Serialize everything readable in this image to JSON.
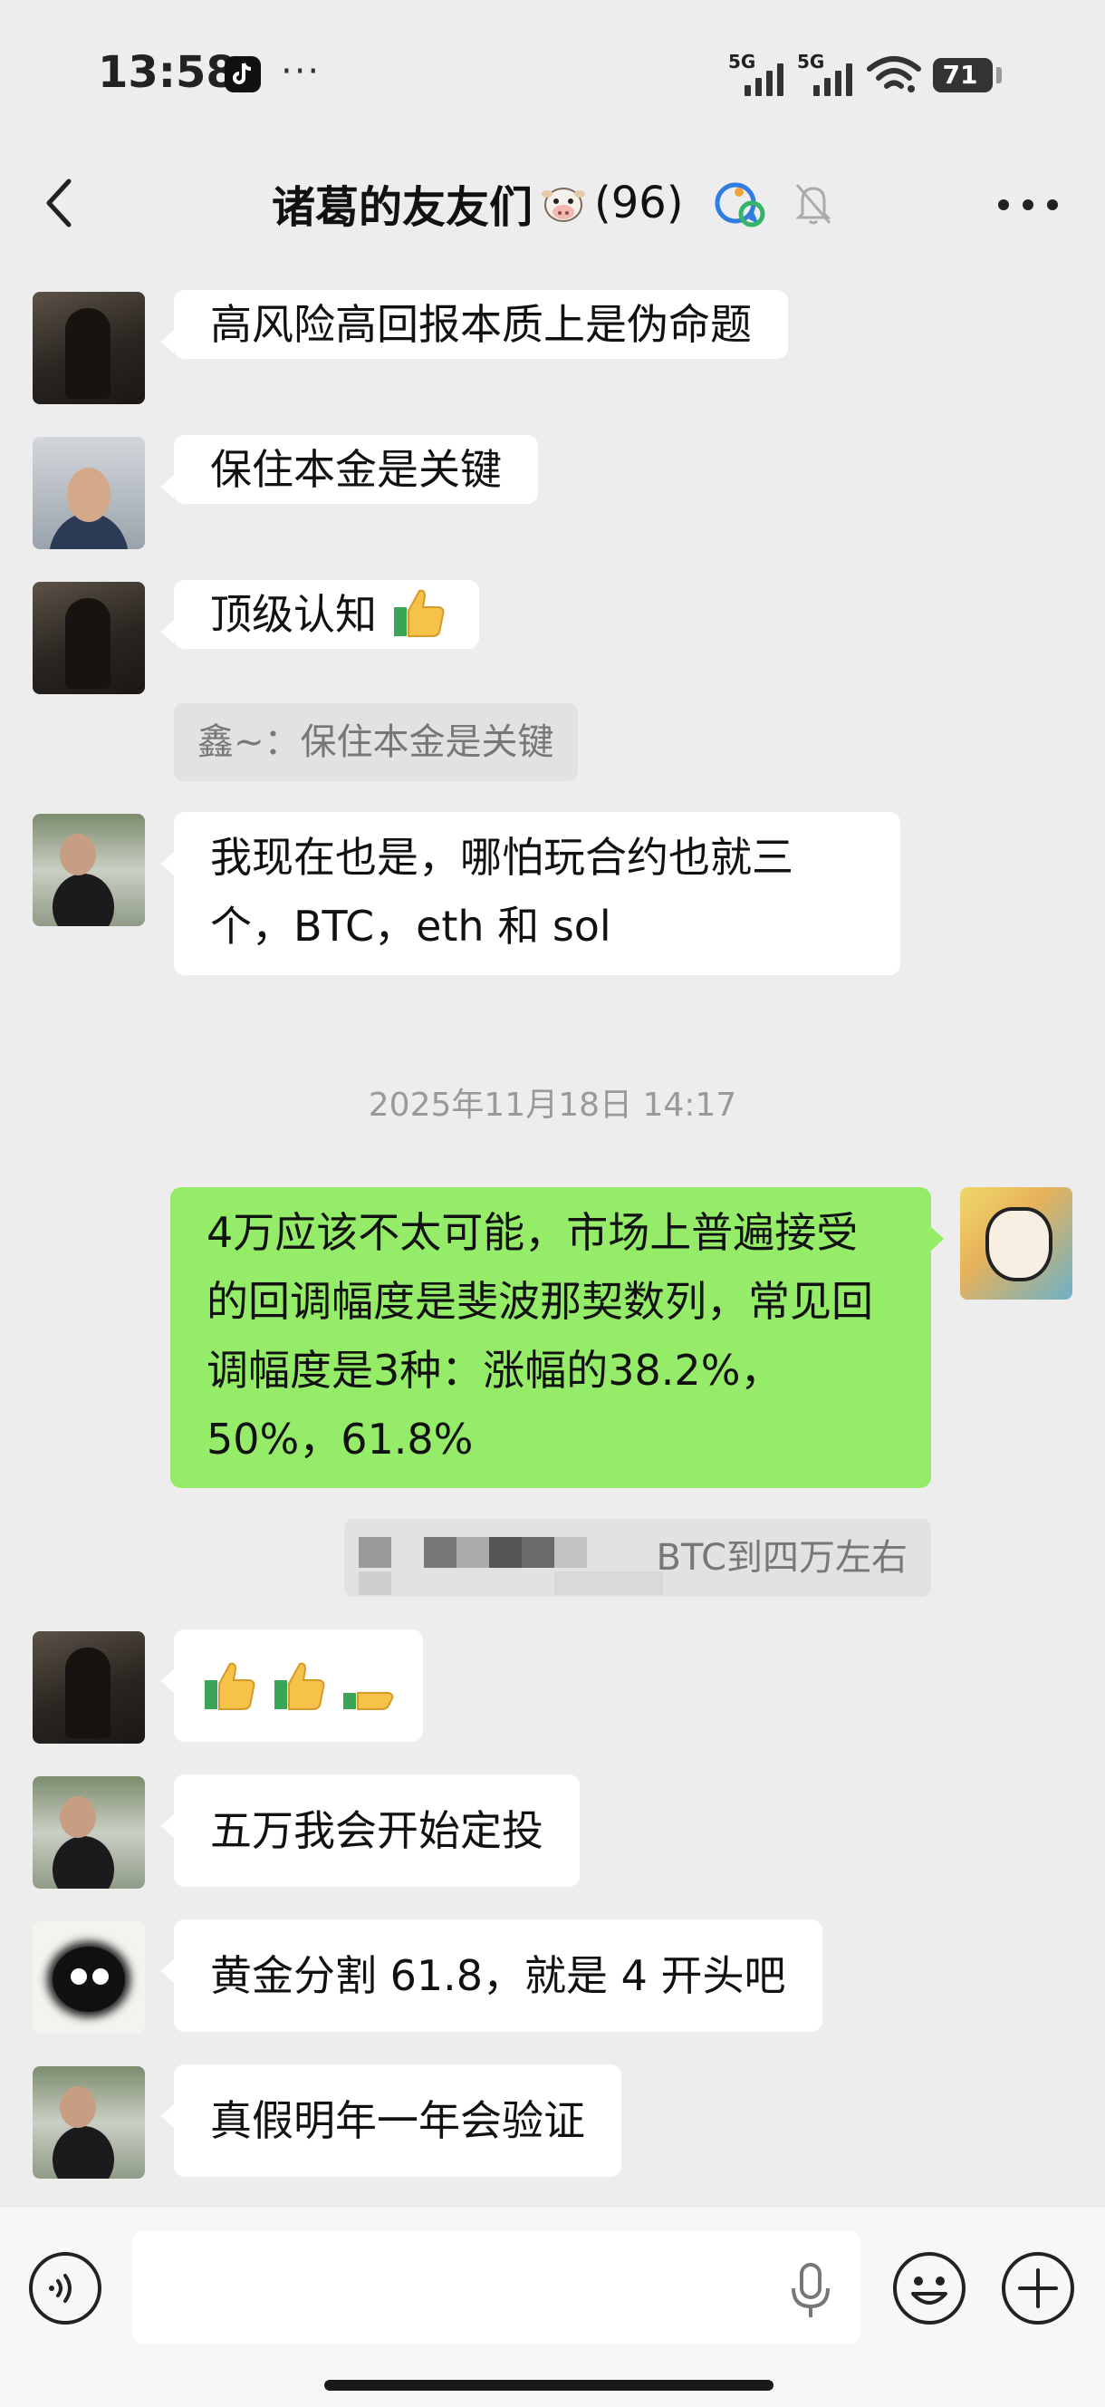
{
  "status_bar": {
    "time": "13:58",
    "dots": "···",
    "signal_1": "5G",
    "signal_2": "5G",
    "battery": "71"
  },
  "nav": {
    "title": "诸葛的友友们",
    "count": "(96)"
  },
  "messages": [
    {
      "sender": "left",
      "text": "高风险高回报本质上是伪命题"
    },
    {
      "sender": "left",
      "text": "保住本金是关键"
    },
    {
      "sender": "left",
      "text": "顶级认知"
    },
    {
      "quote": "鑫~：保住本金是关键"
    },
    {
      "sender": "left",
      "text": "我现在也是，哪怕玩合约也就三个，BTC，eth 和 sol"
    },
    {
      "timestamp": "2025年11月18日 14:17"
    },
    {
      "sender": "right",
      "text": "4万应该不太可能，市场上普遍接受的回调幅度是斐波那契数列，常见回调幅度是3种：涨幅的38.2%，50%，61.8%"
    },
    {
      "quote": "BTC到四万左右"
    },
    {
      "sender": "left",
      "emoji": "thumbs-up x3"
    },
    {
      "sender": "left",
      "text": "五万我会开始定投"
    },
    {
      "sender": "left",
      "text": "黄金分割 61.8，就是 4 开头吧"
    },
    {
      "sender": "left",
      "text": "真假明年一年会验证"
    }
  ],
  "input": {
    "placeholder": ""
  },
  "colors": {
    "background": "#ededed",
    "bubble_other": "#ffffff",
    "bubble_self": "#95ec69",
    "quote_bg": "#e2e2e2"
  }
}
